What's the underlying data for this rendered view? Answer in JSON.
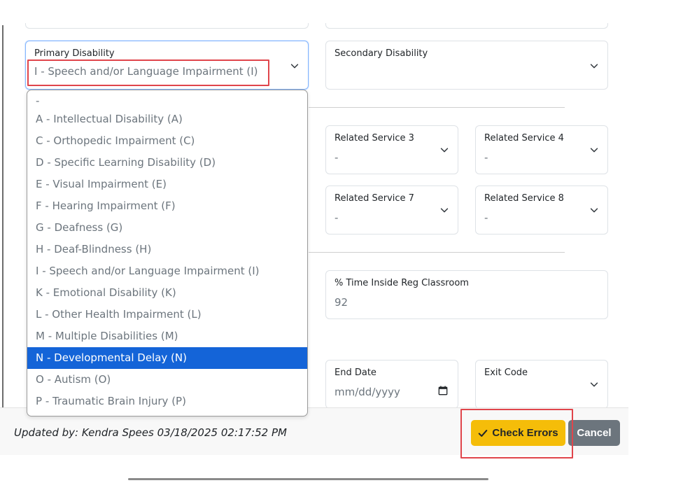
{
  "form": {
    "primary_disability": {
      "label": "Primary Disability",
      "value": "I - Speech and/or Language Impairment (I)"
    },
    "secondary_disability": {
      "label": "Secondary Disability",
      "value": ""
    },
    "related_service_3": {
      "label": "Related Service 3",
      "value": "-"
    },
    "related_service_4": {
      "label": "Related Service 4",
      "value": "-"
    },
    "related_service_7": {
      "label": "Related Service 7",
      "value": "-"
    },
    "related_service_8": {
      "label": "Related Service 8",
      "value": "-"
    },
    "time_inside": {
      "label": "% Time Inside Reg Classroom",
      "value": "92"
    },
    "end_date": {
      "label": "End Date",
      "placeholder": "mm/dd/yyyy"
    },
    "exit_code": {
      "label": "Exit Code",
      "value": ""
    }
  },
  "dropdown": {
    "selected_index": 13,
    "options": [
      "-",
      "A - Intellectual Disability (A)",
      "C - Orthopedic Impairment (C)",
      "D - Specific Learning Disability (D)",
      "E - Visual Impairment (E)",
      "F - Hearing Impairment (F)",
      "G - Deafness (G)",
      "H - Deaf-Blindness (H)",
      "I - Speech and/or Language Impairment (I)",
      "K - Emotional Disability (K)",
      "L - Other Health Impairment (L)",
      "M - Multiple Disabilities (M)",
      "N - Developmental Delay (N)",
      "O - Autism (O)",
      "P - Traumatic Brain Injury (P)"
    ]
  },
  "footer": {
    "updated_text": "Updated by: Kendra Spees 03/18/2025 02:17:52 PM",
    "check_errors_label": "Check Errors",
    "cancel_label": "Cancel"
  },
  "colors": {
    "accent": "#1464d8",
    "warning": "#f5bd09",
    "secondary": "#6c757d",
    "highlight_box": "#e0454b"
  },
  "icons": {
    "select_caret": "chevron-down-icon",
    "check": "check-icon",
    "calendar": "calendar-icon"
  }
}
